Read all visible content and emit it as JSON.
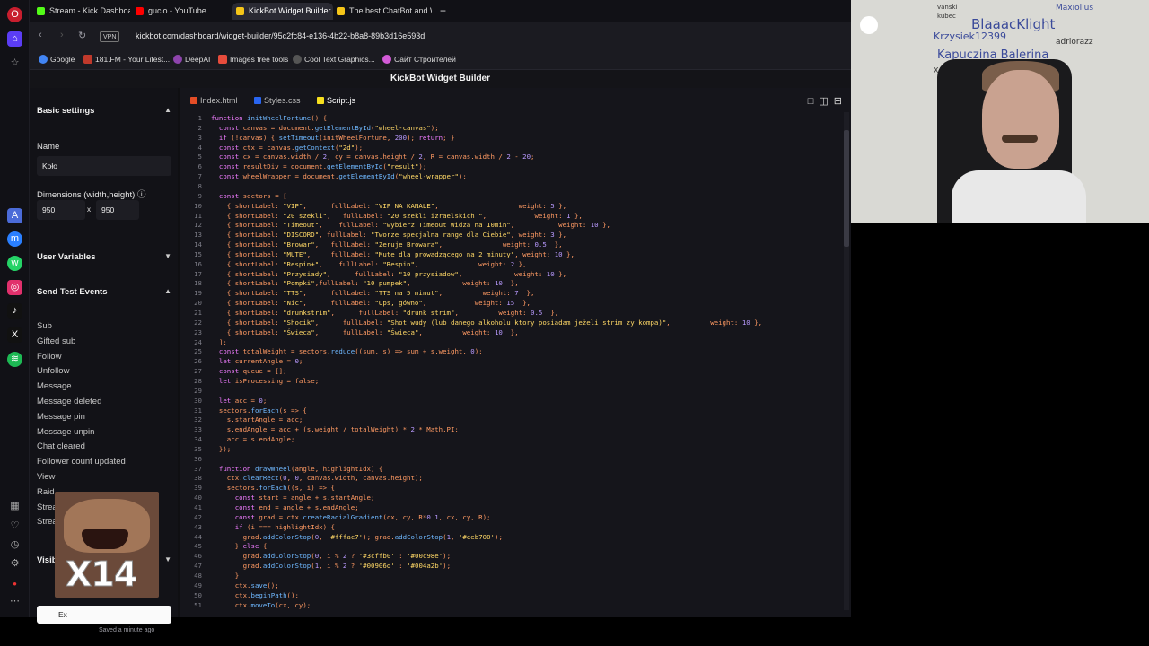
{
  "browser": {
    "tabs": [
      {
        "label": "Stream - Kick Dashboard",
        "color": "#53fc18"
      },
      {
        "label": "gucio - YouTube",
        "color": "#ff0000"
      },
      {
        "label": "KickBot Widget Builder",
        "color": "#f5c518",
        "active": true
      },
      {
        "label": "The best ChatBot and Wi",
        "color": "#f5c518"
      }
    ],
    "new_tab": "+",
    "vpn": "VPN",
    "url": "kickbot.com/dashboard/widget-builder/95c2fc84-e136-4b22-b8a8-89b3d16e593d",
    "bookmarks": [
      {
        "label": "Google",
        "color": "#4285f4"
      },
      {
        "label": "181.FM - Your Lifest...",
        "color": "#c0392b"
      },
      {
        "label": "DeepAI",
        "color": "#8e44ad"
      },
      {
        "label": "Images free tools",
        "color": "#e74c3c"
      },
      {
        "label": "Cool Text Graphics...",
        "color": "#555555"
      },
      {
        "label": "Сайт Строителей",
        "color": "#d35bd8"
      }
    ]
  },
  "page": {
    "title": "KickBot Widget Builder"
  },
  "panel": {
    "basic_settings": "Basic settings",
    "name_label": "Name",
    "name_value": "Koło",
    "dimensions_label": "Dimensions (width,height)",
    "info_icon": "ⓘ",
    "width": "950",
    "times": "x",
    "height": "950",
    "user_variables": "User Variables",
    "send_test_events": "Send Test Events",
    "events": [
      "Sub",
      "Gifted sub",
      "Follow",
      "Unfollow",
      "Message",
      "Message deleted",
      "Message pin",
      "Message unpin",
      "Chat cleared",
      "Follower count updated",
      "View",
      "Raid",
      "Strea",
      "Strea"
    ],
    "visible": "Visib",
    "emote_text": "X14",
    "export_label": "Ex",
    "saved": "Saved a minute ago"
  },
  "editor": {
    "tabs": [
      "Index.html",
      "Styles.css",
      "Script.js"
    ],
    "active_tab": "Script.js",
    "lines": [
      "function initWheelFortune() {",
      "  const canvas = document.getElementById(\"wheel-canvas\");",
      "  if (!canvas) { setTimeout(initWheelFortune, 200); return; }",
      "  const ctx = canvas.getContext(\"2d\");",
      "  const cx = canvas.width / 2, cy = canvas.height / 2, R = canvas.width / 2 - 20;",
      "  const resultDiv = document.getElementById(\"result\");",
      "  const wheelWrapper = document.getElementById(\"wheel-wrapper\");",
      "",
      "  const sectors = [",
      "    { shortLabel: \"VIP\",      fullLabel: \"VIP NA KANALE\",                    weight: 5 },",
      "    { shortLabel: \"20 szekli\",   fullLabel: \"20 szekli izraelskich \",            weight: 1 },",
      "    { shortLabel: \"Timeout\",    fullLabel: \"wybierz Timeout Widza na 10min\",           weight: 10 },",
      "    { shortLabel: \"DISCORD\", fullLabel: \"Tworze specjalna range dla Ciebie\", weight: 3 },",
      "    { shortLabel: \"Browar\",   fullLabel: \"Zeruje Browara\",               weight: 0.5  },",
      "    { shortLabel: \"MUTE\",     fullLabel: \"Mute dla prowadzącego na 2 minuty\", weight: 10 },",
      "    { shortLabel: \"Respin+\",    fullLabel: \"Respin\",               weight: 2 },",
      "    { shortLabel: \"Przysiady\",      fullLabel: \"10 przysiadow\",             weight: 10 },",
      "    { shortLabel: \"Pompki\",fullLabel: \"10 pumpek\",             weight: 10  },",
      "    { shortLabel: \"TTS\",      fullLabel: \"TTS na 5 minut\",          weight: 7  },",
      "    { shortLabel: \"Nic\",      fullLabel: \"Ups, gówno\",            weight: 15  },",
      "    { shortLabel: \"drunkstrim\",      fullLabel: \"drunk strim\",          weight: 0.5  },",
      "    { shortLabel: \"Shocik\",      fullLabel: \"Shot wudy (lub danego alkoholu ktory posiadam jeżeli strim zy kompa)\",          weight: 10 },",
      "    { shortLabel: \"Świeca\",      fullLabel: \"Świeca\",          weight: 10  },",
      "  ];",
      "  const totalWeight = sectors.reduce((sum, s) => sum + s.weight, 0);",
      "  let currentAngle = 0;",
      "  const queue = [];",
      "  let isProcessing = false;",
      "",
      "  let acc = 0;",
      "  sectors.forEach(s => {",
      "    s.startAngle = acc;",
      "    s.endAngle = acc + (s.weight / totalWeight) * 2 * Math.PI;",
      "    acc = s.endAngle;",
      "  });",
      "",
      "  function drawWheel(angle, highlightIdx) {",
      "    ctx.clearRect(0, 0, canvas.width, canvas.height);",
      "    sectors.forEach((s, i) => {",
      "      const start = angle + s.startAngle;",
      "      const end = angle + s.endAngle;",
      "      const grad = ctx.createRadialGradient(cx, cy, R*0.1, cx, cy, R);",
      "      if (i === highlightIdx) {",
      "        grad.addColorStop(0, '#fffac7'); grad.addColorStop(1, '#eeb700');",
      "      } else {",
      "        grad.addColorStop(0, i % 2 ? '#3cffb0' : '#00c98e');",
      "        grad.addColorStop(1, i % 2 ? '#00906d' : '#004a2b');",
      "      }",
      "      ctx.save();",
      "      ctx.beginPath();",
      "      ctx.moveTo(cx, cy);"
    ]
  },
  "webcam": {
    "wall_names": [
      "Maxiollus",
      "vanski",
      "kubec",
      "BlaaacKlight",
      "Krzysiek12399",
      "adriorazz",
      "Kapuczina Balerina",
      "Xdristrojan"
    ]
  }
}
